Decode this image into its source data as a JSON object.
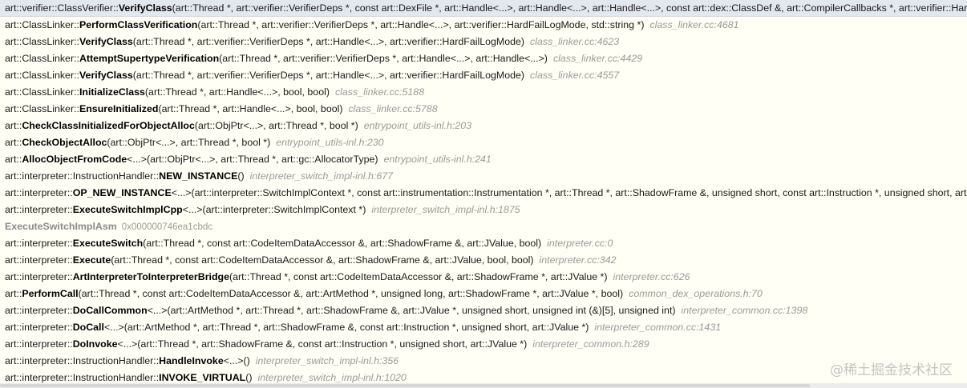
{
  "frames": [
    {
      "pre": "art::verifier::ClassVerifier::",
      "fn": "VerifyClass",
      "post": "(art::Thread *, art::verifier::VerifierDeps *, const art::DexFile *, art::Handle<...>, art::Handle<...>, art::Handle<...>, const art::dex::ClassDef &, art::CompilerCallbacks *, art::verifier::HardFailLogMode, unsigned int, std::string *)",
      "loc": "",
      "selected": true
    },
    {
      "pre": "art::ClassLinker::",
      "fn": "PerformClassVerification",
      "post": "(art::Thread *, art::verifier::VerifierDeps *, art::Handle<...>, art::verifier::HardFailLogMode, std::string *)",
      "loc": "class_linker.cc:4681"
    },
    {
      "pre": "art::ClassLinker::",
      "fn": "VerifyClass",
      "post": "(art::Thread *, art::verifier::VerifierDeps *, art::Handle<...>, art::verifier::HardFailLogMode)",
      "loc": "class_linker.cc:4623"
    },
    {
      "pre": "art::ClassLinker::",
      "fn": "AttemptSupertypeVerification",
      "post": "(art::Thread *, art::verifier::VerifierDeps *, art::Handle<...>, art::Handle<...>)",
      "loc": "class_linker.cc:4429"
    },
    {
      "pre": "art::ClassLinker::",
      "fn": "VerifyClass",
      "post": "(art::Thread *, art::verifier::VerifierDeps *, art::Handle<...>, art::verifier::HardFailLogMode)",
      "loc": "class_linker.cc:4557"
    },
    {
      "pre": "art::ClassLinker::",
      "fn": "InitializeClass",
      "post": "(art::Thread *, art::Handle<...>, bool, bool)",
      "loc": "class_linker.cc:5188"
    },
    {
      "pre": "art::ClassLinker::",
      "fn": "EnsureInitialized",
      "post": "(art::Thread *, art::Handle<...>, bool, bool)",
      "loc": "class_linker.cc:5788"
    },
    {
      "pre": "art::",
      "fn": "CheckClassInitializedForObjectAlloc",
      "post": "(art::ObjPtr<...>, art::Thread *, bool *)",
      "loc": "entrypoint_utils-inl.h:203"
    },
    {
      "pre": "art::",
      "fn": "CheckObjectAlloc",
      "post": "(art::ObjPtr<...>, art::Thread *, bool *)",
      "loc": "entrypoint_utils-inl.h:230"
    },
    {
      "pre": "art::",
      "fn": "AllocObjectFromCode",
      "post": "<...>(art::ObjPtr<...>, art::Thread *, art::gc::AllocatorType)",
      "loc": "entrypoint_utils-inl.h:241"
    },
    {
      "pre": "art::interpreter::InstructionHandler::",
      "fn": "NEW_INSTANCE",
      "post": "()",
      "loc": "interpreter_switch_impl-inl.h:677"
    },
    {
      "pre": "art::interpreter::",
      "fn": "OP_NEW_INSTANCE",
      "post": "<...>(art::interpreter::SwitchImplContext *, const art::instrumentation::Instrumentation *, art::Thread *, art::ShadowFrame &, unsigned short, const art::Instruction *, unsigned short, art::JValue *)",
      "loc": ""
    },
    {
      "pre": "art::interpreter::",
      "fn": "ExecuteSwitchImplCpp",
      "post": "<...>(art::interpreter::SwitchImplContext *)",
      "loc": "interpreter_switch_impl-inl.h:1875"
    },
    {
      "pre": "",
      "fn": "ExecuteSwitchImplAsm",
      "post": "",
      "loc": "",
      "addr": "0x000000746ea1cbdc",
      "asm": true
    },
    {
      "pre": "art::interpreter::",
      "fn": "ExecuteSwitch",
      "post": "(art::Thread *, const art::CodeItemDataAccessor &, art::ShadowFrame &, art::JValue, bool)",
      "loc": "interpreter.cc:0"
    },
    {
      "pre": "art::interpreter::",
      "fn": "Execute",
      "post": "(art::Thread *, const art::CodeItemDataAccessor &, art::ShadowFrame &, art::JValue, bool, bool)",
      "loc": "interpreter.cc:342"
    },
    {
      "pre": "art::interpreter::",
      "fn": "ArtInterpreterToInterpreterBridge",
      "post": "(art::Thread *, const art::CodeItemDataAccessor &, art::ShadowFrame *, art::JValue *)",
      "loc": "interpreter.cc:626"
    },
    {
      "pre": "art::",
      "fn": "PerformCall",
      "post": "(art::Thread *, const art::CodeItemDataAccessor &, art::ArtMethod *, unsigned long, art::ShadowFrame *, art::JValue *, bool)",
      "loc": "common_dex_operations.h:70"
    },
    {
      "pre": "art::interpreter::",
      "fn": "DoCallCommon",
      "post": "<...>(art::ArtMethod *, art::Thread *, art::ShadowFrame &, art::JValue *, unsigned short, unsigned int (&)[5], unsigned int)",
      "loc": "interpreter_common.cc:1398"
    },
    {
      "pre": "art::interpreter::",
      "fn": "DoCall",
      "post": "<...>(art::ArtMethod *, art::Thread *, art::ShadowFrame &, const art::Instruction *, unsigned short, art::JValue *)",
      "loc": "interpreter_common.cc:1431"
    },
    {
      "pre": "art::interpreter::",
      "fn": "DoInvoke",
      "post": "<...>(art::Thread *, art::ShadowFrame &, const art::Instruction *, unsigned short, art::JValue *)",
      "loc": "interpreter_common.h:289"
    },
    {
      "pre": "art::interpreter::InstructionHandler::",
      "fn": "HandleInvoke",
      "post": "<...>()",
      "loc": "interpreter_switch_impl-inl.h:356"
    },
    {
      "pre": "art::interpreter::InstructionHandler::",
      "fn": "INVOKE_VIRTUAL",
      "post": "()",
      "loc": "interpreter_switch_impl-inl.h:1020"
    }
  ],
  "watermark": {
    "text": "@稀土掘金技术社区"
  }
}
